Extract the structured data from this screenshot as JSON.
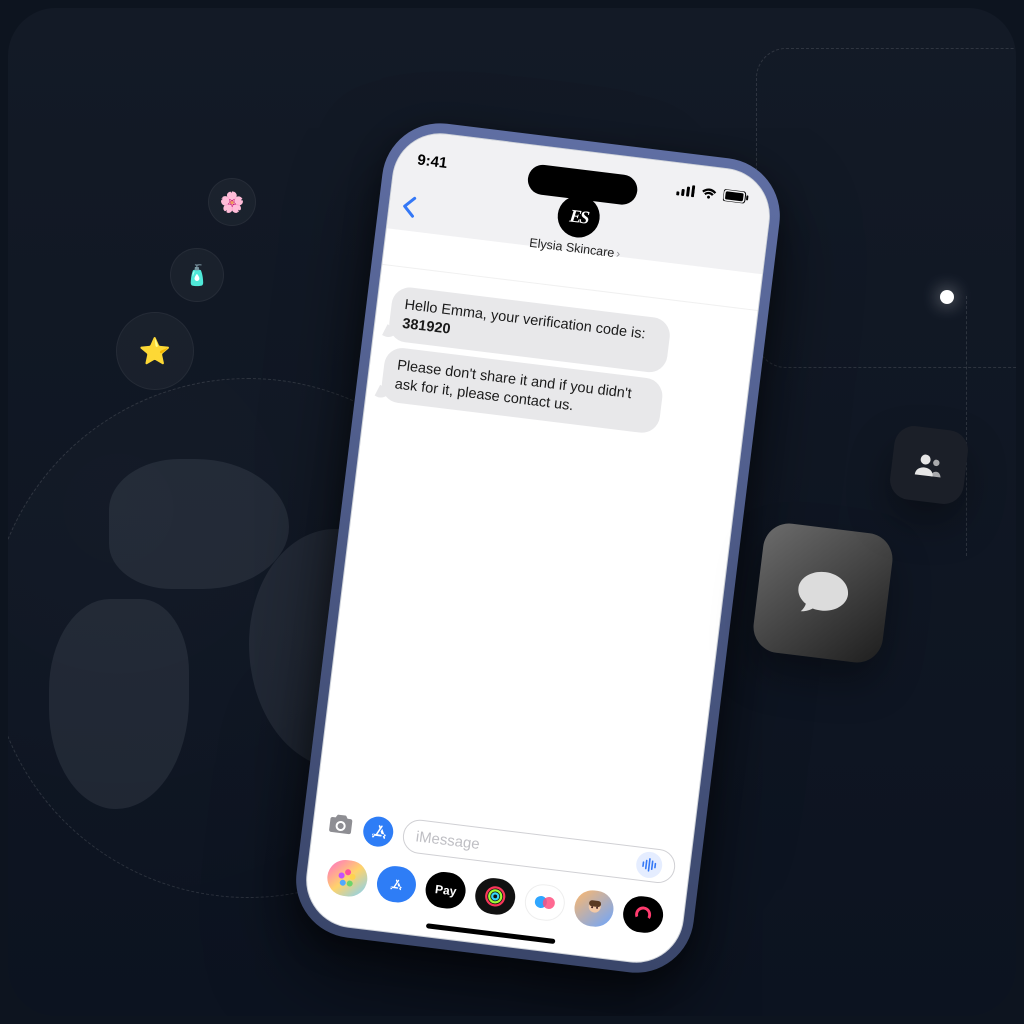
{
  "status": {
    "time": "9:41"
  },
  "header": {
    "avatar_initials": "ES",
    "contact_name_label": "Elysia Skincare"
  },
  "messages": [
    {
      "prefix": "Hello Emma, your verification code is: ",
      "code": "381920"
    },
    {
      "text": "Please don't share it and if you didn't ask for it, please contact us."
    }
  ],
  "input": {
    "placeholder": "iMessage"
  },
  "tray": {
    "apple_pay_label": "Pay"
  },
  "decor": {
    "bubble_glyphs": {
      "flower": "🌸",
      "star": "⭐",
      "bottle": "🧴"
    }
  }
}
